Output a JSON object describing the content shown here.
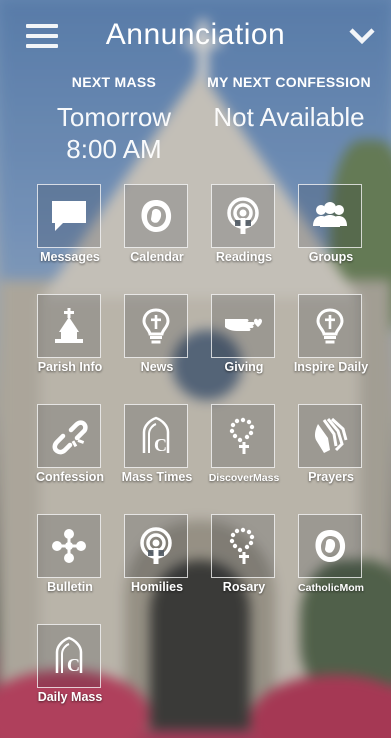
{
  "header": {
    "title": "Annunciation"
  },
  "next_mass": {
    "label": "NEXT MASS",
    "day": "Tomorrow",
    "time": "8:00 AM"
  },
  "next_confession": {
    "label": "MY NEXT CONFESSION",
    "value": "Not Available"
  },
  "tiles": [
    {
      "label": "Messages",
      "icon": "speech-bubble-icon"
    },
    {
      "label": "Calendar",
      "icon": "mary-head-icon"
    },
    {
      "label": "Readings",
      "icon": "podcast-icon"
    },
    {
      "label": "Groups",
      "icon": "people-icon"
    },
    {
      "label": "Parish Info",
      "icon": "church-icon"
    },
    {
      "label": "News",
      "icon": "lightbulb-cross-icon"
    },
    {
      "label": "Giving",
      "icon": "hand-heart-icon"
    },
    {
      "label": "Inspire Daily",
      "icon": "lightbulb-cross-icon"
    },
    {
      "label": "Confession",
      "icon": "broken-chain-icon"
    },
    {
      "label": "Mass Times",
      "icon": "chapel-c-icon"
    },
    {
      "label": "DiscoverMass",
      "icon": "rosary-icon"
    },
    {
      "label": "Prayers",
      "icon": "praying-hands-icon"
    },
    {
      "label": "Bulletin",
      "icon": "quatrefoil-icon"
    },
    {
      "label": "Homilies",
      "icon": "podcast-icon"
    },
    {
      "label": "Rosary",
      "icon": "rosary-icon"
    },
    {
      "label": "CatholicMom",
      "icon": "mary-head-icon"
    },
    {
      "label": "Daily Mass",
      "icon": "chapel-c-icon"
    }
  ]
}
